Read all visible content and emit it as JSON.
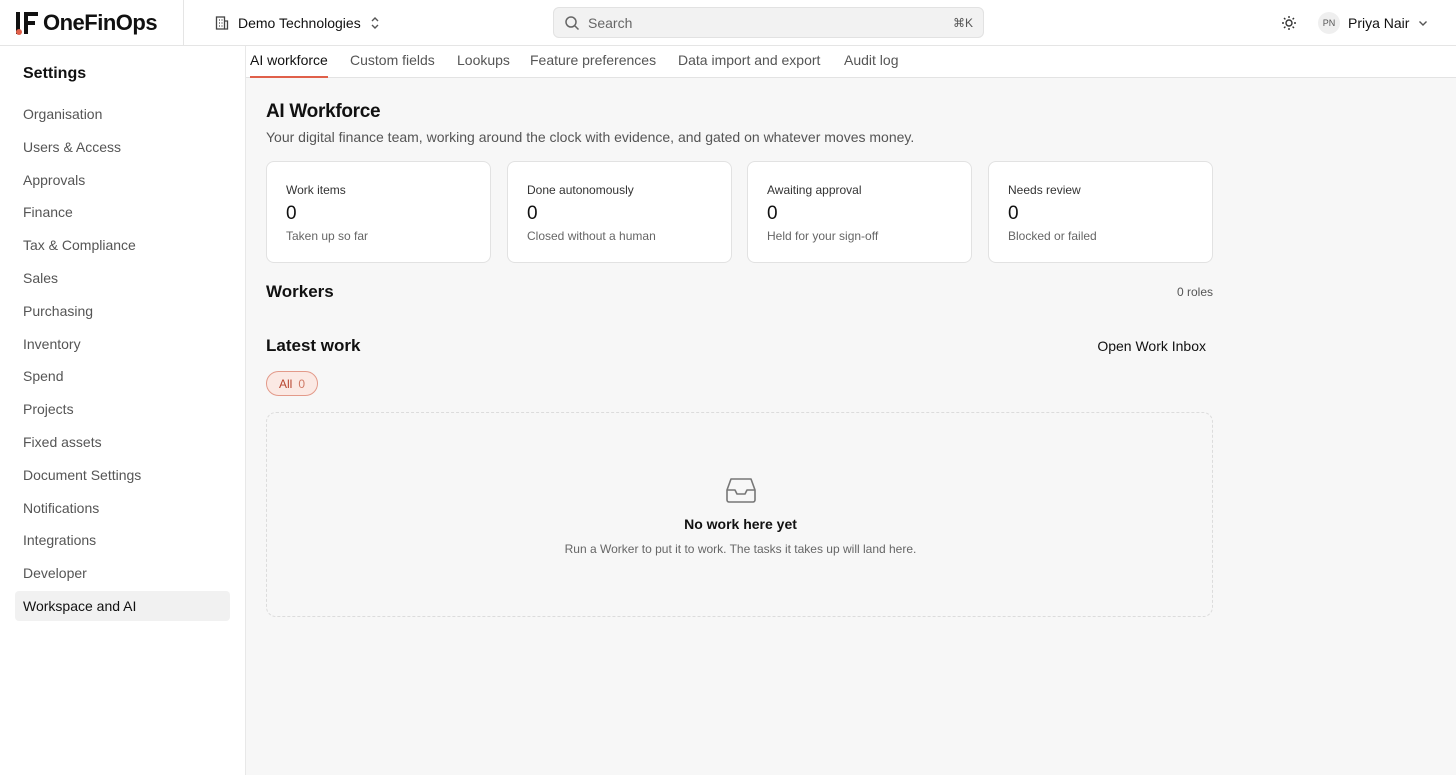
{
  "app": {
    "brand": "OneFinOps",
    "organization": "Demo Technologies",
    "search": {
      "placeholder": "Search",
      "shortcut": "⌘K"
    },
    "user": {
      "initials": "PN",
      "name": "Priya Nair"
    },
    "icons": [
      "building-icon",
      "chevron-updown-icon",
      "search-icon",
      "sun-icon",
      "chevron-down-icon",
      "inbox-icon"
    ],
    "accent_color": "#e0604a"
  },
  "sidebar": {
    "title": "Settings",
    "items": [
      {
        "label": "Organisation",
        "active": false
      },
      {
        "label": "Users & Access",
        "active": false
      },
      {
        "label": "Approvals",
        "active": false
      },
      {
        "label": "Finance",
        "active": false
      },
      {
        "label": "Tax & Compliance",
        "active": false
      },
      {
        "label": "Sales",
        "active": false
      },
      {
        "label": "Purchasing",
        "active": false
      },
      {
        "label": "Inventory",
        "active": false
      },
      {
        "label": "Spend",
        "active": false
      },
      {
        "label": "Projects",
        "active": false
      },
      {
        "label": "Fixed assets",
        "active": false
      },
      {
        "label": "Document Settings",
        "active": false
      },
      {
        "label": "Notifications",
        "active": false
      },
      {
        "label": "Integrations",
        "active": false
      },
      {
        "label": "Developer",
        "active": false
      },
      {
        "label": "Workspace and AI",
        "active": true
      }
    ]
  },
  "tabs": [
    {
      "label": "AI workforce",
      "active": true
    },
    {
      "label": "Custom fields",
      "active": false
    },
    {
      "label": "Lookups",
      "active": false
    },
    {
      "label": "Feature preferences",
      "active": false
    },
    {
      "label": "Data import and export",
      "active": false
    },
    {
      "label": "Audit log",
      "active": false
    }
  ],
  "page": {
    "title": "AI Workforce",
    "subtitle": "Your digital finance team, working around the clock with evidence, and gated on whatever moves money."
  },
  "stats": [
    {
      "label": "Work items",
      "value": "0",
      "note": "Taken up so far"
    },
    {
      "label": "Done autonomously",
      "value": "0",
      "note": "Closed without a human"
    },
    {
      "label": "Awaiting approval",
      "value": "0",
      "note": "Held for your sign-off"
    },
    {
      "label": "Needs review",
      "value": "0",
      "note": "Blocked or failed"
    }
  ],
  "workers": {
    "title": "Workers",
    "count_label": "0 roles"
  },
  "latest_work": {
    "title": "Latest work",
    "open_inbox_label": "Open Work Inbox",
    "filter": {
      "label": "All",
      "count": "0"
    },
    "empty": {
      "title": "No work here yet",
      "text": "Run a Worker to put it to work. The tasks it takes up will land here."
    }
  }
}
